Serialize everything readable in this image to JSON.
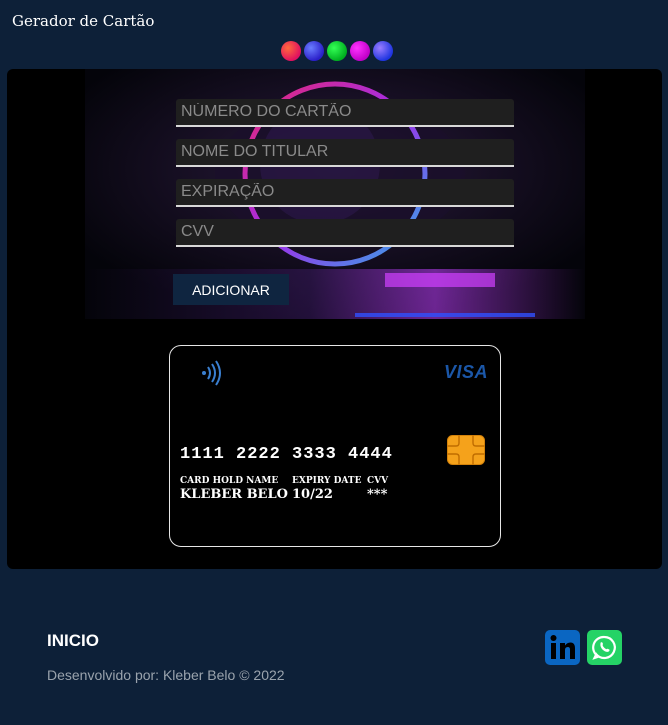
{
  "app": {
    "title": "Gerador de Cartão"
  },
  "theme": {
    "swatches": [
      {
        "name": "red-orange",
        "color": "#ff3d5a"
      },
      {
        "name": "blue",
        "color": "#3a3dff"
      },
      {
        "name": "green",
        "color": "#22e03a"
      },
      {
        "name": "magenta",
        "color": "#e61ae6"
      },
      {
        "name": "violet-blue",
        "color": "#4a4aff"
      }
    ]
  },
  "form": {
    "card_number_placeholder": "NÚMERO DO CARTÃO",
    "holder_name_placeholder": "NOME DO TITULAR",
    "expiration_placeholder": "EXPIRAÇÃO",
    "cvv_placeholder": "CVV",
    "add_button_label": "ADICIONAR"
  },
  "card": {
    "brand": "VISA",
    "number": "1111 2222 3333 4444",
    "holder_label": "CARD HOLD NAME",
    "holder_value": "KLEBER BELO",
    "expiry_label": "EXPIRY DATE",
    "expiry_value": "10/22",
    "cvv_label": "CVV",
    "cvv_value": "***"
  },
  "footer": {
    "title": "INICIO",
    "credit": "Desenvolvido por: Kleber Belo © 2022",
    "social": [
      {
        "name": "linkedin",
        "icon": "linkedin-icon",
        "color": "#0a66c2"
      },
      {
        "name": "whatsapp",
        "icon": "whatsapp-icon",
        "color": "#25d366"
      }
    ]
  }
}
